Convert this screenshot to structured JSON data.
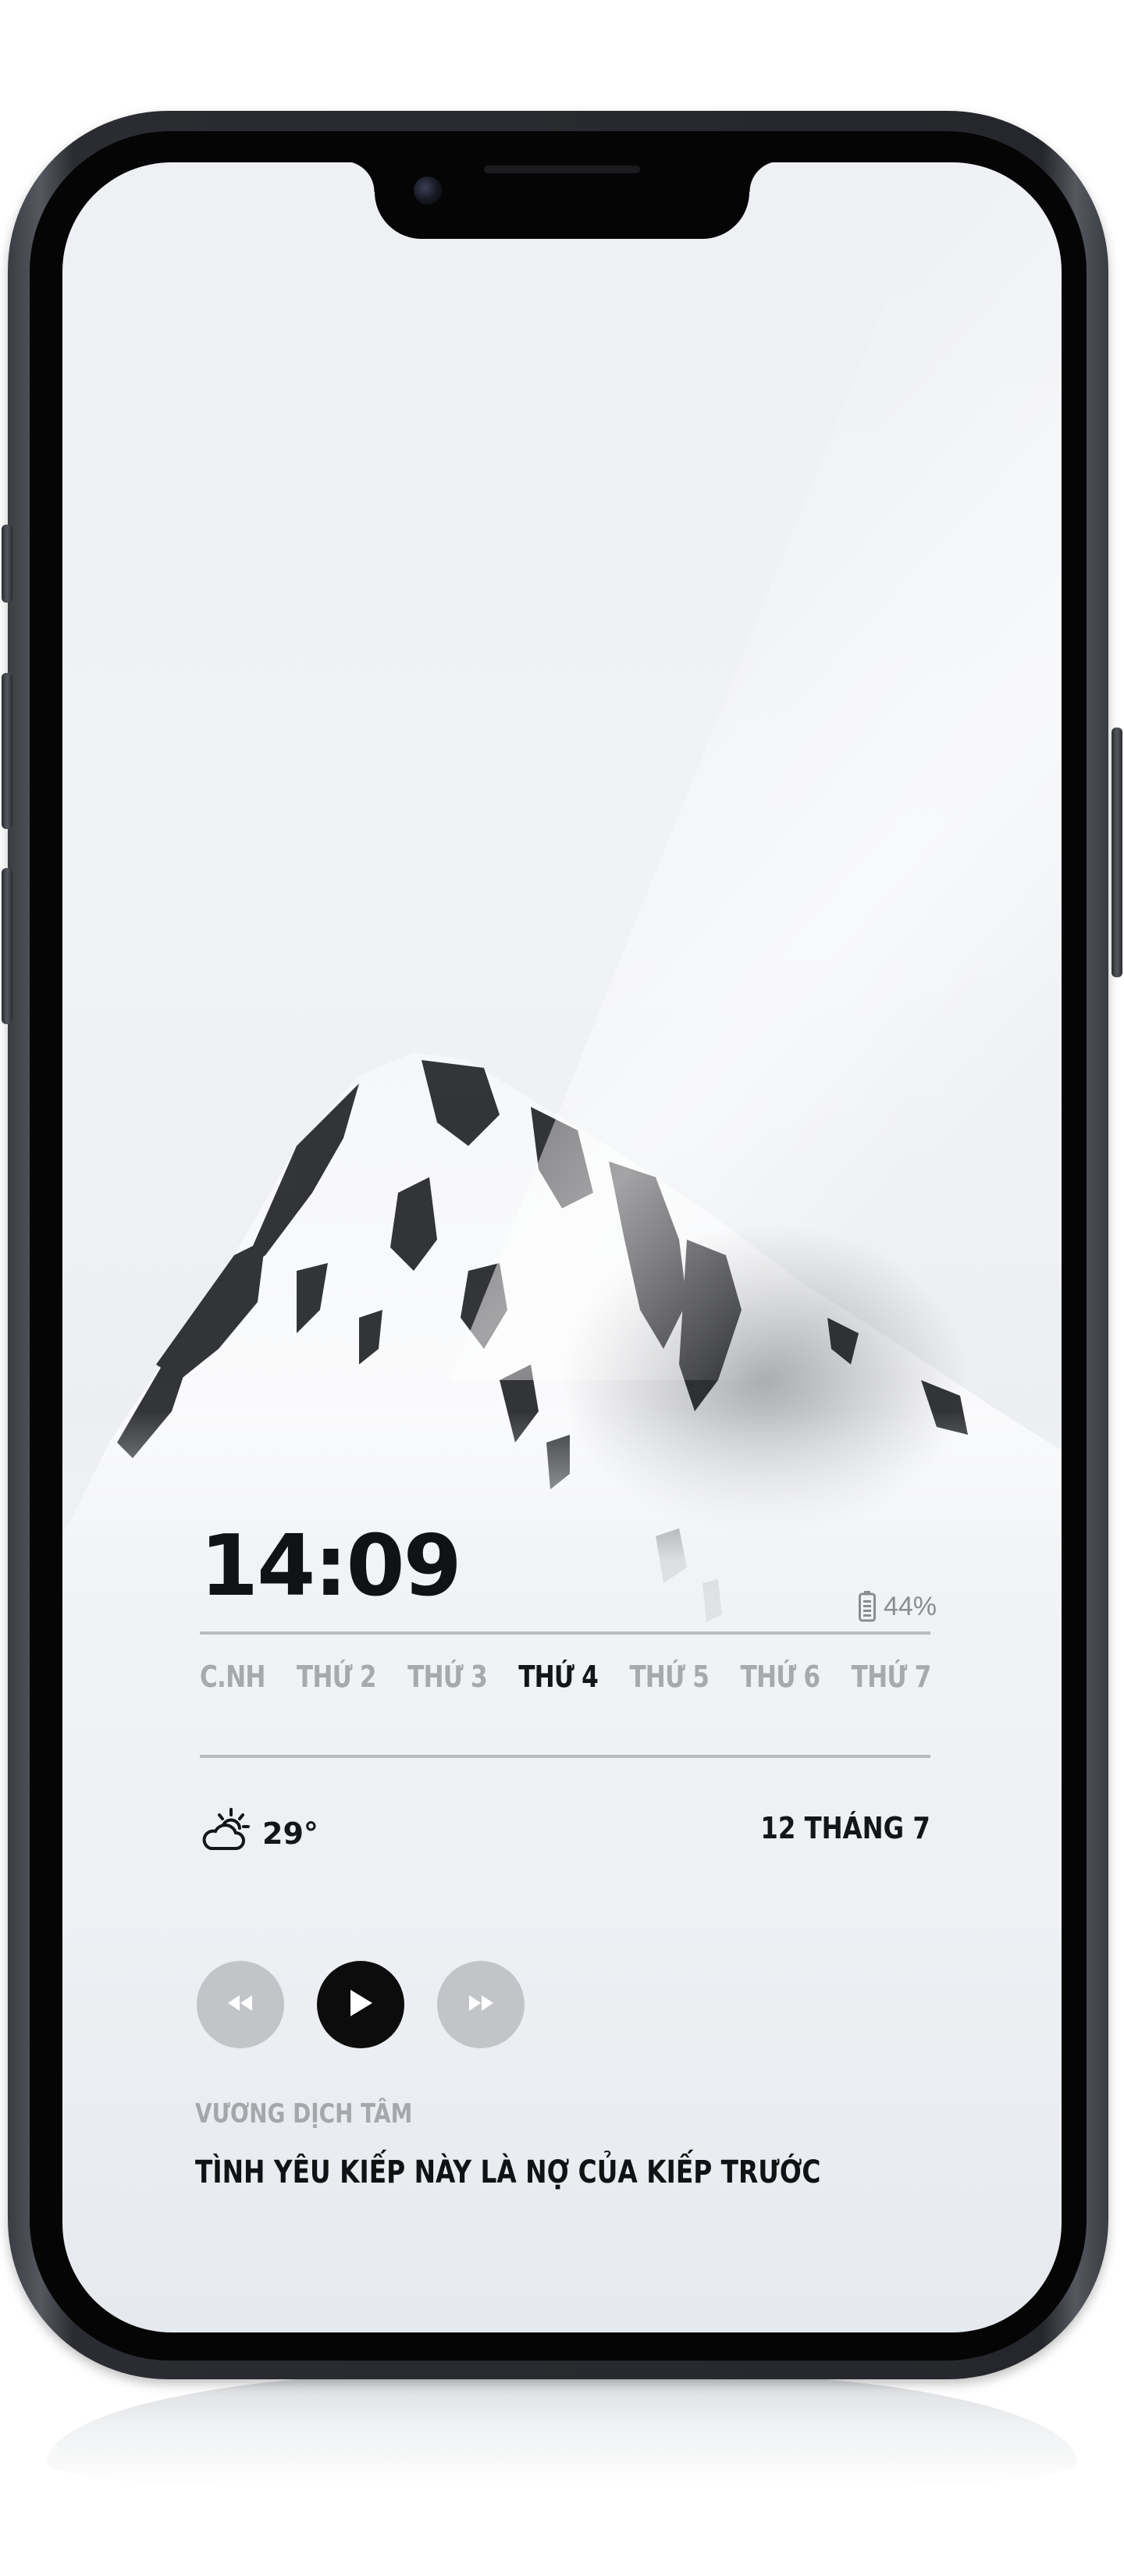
{
  "lockscreen": {
    "time": "14:09",
    "battery": {
      "percent_label": "44%",
      "icon": "battery-icon"
    },
    "days": [
      {
        "label": "C.NH",
        "active": false
      },
      {
        "label": "THỨ 2",
        "active": false
      },
      {
        "label": "THỨ 3",
        "active": false
      },
      {
        "label": "THỨ 4",
        "active": true
      },
      {
        "label": "THỨ 5",
        "active": false
      },
      {
        "label": "THỨ 6",
        "active": false
      },
      {
        "label": "THỨ 7",
        "active": false
      }
    ],
    "weather": {
      "icon": "partly-cloudy-icon",
      "temperature": "29°"
    },
    "date": "12 THÁNG 7",
    "media": {
      "controls": [
        "rewind-icon",
        "play-icon",
        "fast-forward-icon"
      ],
      "artist": "VƯƠNG DỊCH TÂM",
      "title": "TÌNH YÊU KIẾP NÀY LÀ NỢ CỦA KIẾP TRƯỚC"
    }
  },
  "colors": {
    "text_primary": "#111214",
    "text_muted": "#a7a9ad",
    "button_secondary": "#c2c4c7",
    "button_primary": "#0c0c0d"
  }
}
